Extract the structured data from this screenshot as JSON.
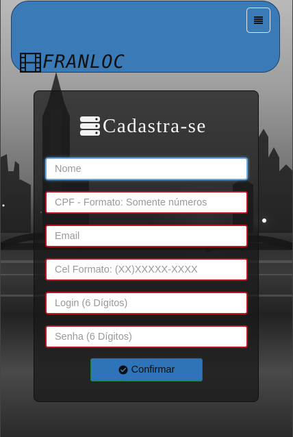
{
  "header": {
    "brand": "FRANLOC",
    "brand_icon": "film-icon",
    "menu_icon": "hamburger-icon",
    "color": "#3a7ab7"
  },
  "form": {
    "title": "Cadastra-se",
    "title_icon": "server-icon",
    "fields": [
      {
        "name": "nome",
        "placeholder": "Nome",
        "value": ""
      },
      {
        "name": "cpf",
        "placeholder": "CPF - Formato: Somente números",
        "value": ""
      },
      {
        "name": "email",
        "placeholder": "Email",
        "value": ""
      },
      {
        "name": "celular",
        "placeholder": "Cel Formato: (XX)XXXXX-XXXX",
        "value": ""
      },
      {
        "name": "login",
        "placeholder": "Login (6 Dígitos)",
        "value": ""
      },
      {
        "name": "senha",
        "placeholder": "Senha (6 Dígitos)",
        "value": ""
      }
    ],
    "submit_label": "Confirmar",
    "submit_icon": "check-circle-icon",
    "invalid_border_color": "#c0121f",
    "focus_border_color": "#66a9e2",
    "button_color": "#2f73b8"
  }
}
